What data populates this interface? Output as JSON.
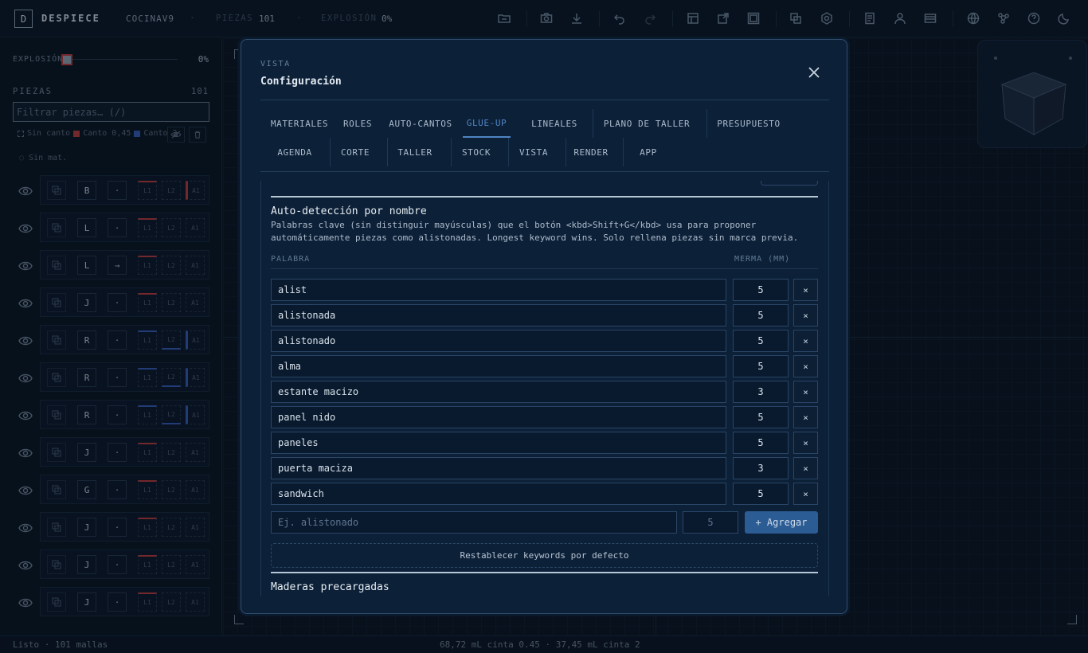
{
  "app": {
    "logo_letter": "D",
    "name": "DESPIECE",
    "project": "COCINAV9",
    "piezas_label": "PIEZAS",
    "piezas_value": "101",
    "explosion_label": "EXPLOSIÓN",
    "explosion_value": "0%"
  },
  "toolbar_icons": [
    "folder-icon",
    "camera-icon",
    "download-icon",
    "undo-icon",
    "redo-icon",
    "table-icon",
    "export-icon",
    "frame-icon",
    "layers-icon",
    "settings-icon",
    "book-icon",
    "user-icon",
    "card-icon",
    "globe-icon",
    "graph-icon",
    "help-icon",
    "moon-icon"
  ],
  "sidebar": {
    "explosion_label": "EXPLOSIÓN",
    "explosion_value": "0%",
    "explosion_level": 0,
    "piezas_title": "PIEZAS",
    "piezas_count": "101",
    "filter_placeholder": "Filtrar piezas… (/)",
    "legend": {
      "sin_canto": "Sin canto",
      "canto_045": "Canto 0,45",
      "canto_2": "Canto 2"
    },
    "sin_mat": "Sin mat.",
    "edge_labels": {
      "l1": "L1",
      "l2": "L2",
      "a1": "A1"
    },
    "rows": [
      {
        "letter": "B",
        "action": "·"
      },
      {
        "letter": "L",
        "action": "·"
      },
      {
        "letter": "L",
        "action": "→"
      },
      {
        "letter": "J",
        "action": "·"
      },
      {
        "letter": "R",
        "action": "·"
      },
      {
        "letter": "R",
        "action": "·"
      },
      {
        "letter": "R",
        "action": "·"
      },
      {
        "letter": "J",
        "action": "·"
      },
      {
        "letter": "G",
        "action": "·"
      },
      {
        "letter": "J",
        "action": "·"
      },
      {
        "letter": "J",
        "action": "·"
      },
      {
        "letter": "J",
        "action": "·"
      }
    ]
  },
  "footer": {
    "status": "Listo · 101 mallas",
    "center": "68,72 mL cinta 0.45 · 37,45 mL cinta 2"
  },
  "modal": {
    "subtitle": "VISTA",
    "title": "Configuración",
    "tabs_row1": [
      "MATERIALES",
      "ROLES",
      "AUTO-CANTOS",
      "GLUE-UP",
      "LINEALES",
      "PLANO DE TALLER",
      "PRESUPUESTO"
    ],
    "tabs_row2": [
      "AGENDA",
      "CORTE",
      "TALLER",
      "STOCK",
      "VISTA",
      "RENDER",
      "APP"
    ],
    "active_tab": "GLUE-UP",
    "section_title": "Auto-detección por nombre",
    "section_desc": "Palabras clave (sin distinguir mayúsculas) que el botón <kbd>Shift+G</kbd> usa para proponer automáticamente piezas como alistonadas. Longest keyword wins. Solo rellena piezas sin marca previa.",
    "col_word": "PALABRA",
    "col_merma": "MERMA (MM)",
    "keywords": [
      {
        "word": "alist",
        "merma": "5"
      },
      {
        "word": "alistonada",
        "merma": "5"
      },
      {
        "word": "alistonado",
        "merma": "5"
      },
      {
        "word": "alma",
        "merma": "5"
      },
      {
        "word": "estante macizo",
        "merma": "3"
      },
      {
        "word": "panel nido",
        "merma": "5"
      },
      {
        "word": "paneles",
        "merma": "5"
      },
      {
        "word": "puerta maciza",
        "merma": "3"
      },
      {
        "word": "sandwich",
        "merma": "5"
      }
    ],
    "remove_label": "×",
    "add_placeholder": "Ej. alistonado",
    "add_merma_placeholder": "5",
    "add_button": "+ Agregar",
    "reset_button": "Restablecer keywords por defecto",
    "next_section": "Maderas precargadas"
  }
}
